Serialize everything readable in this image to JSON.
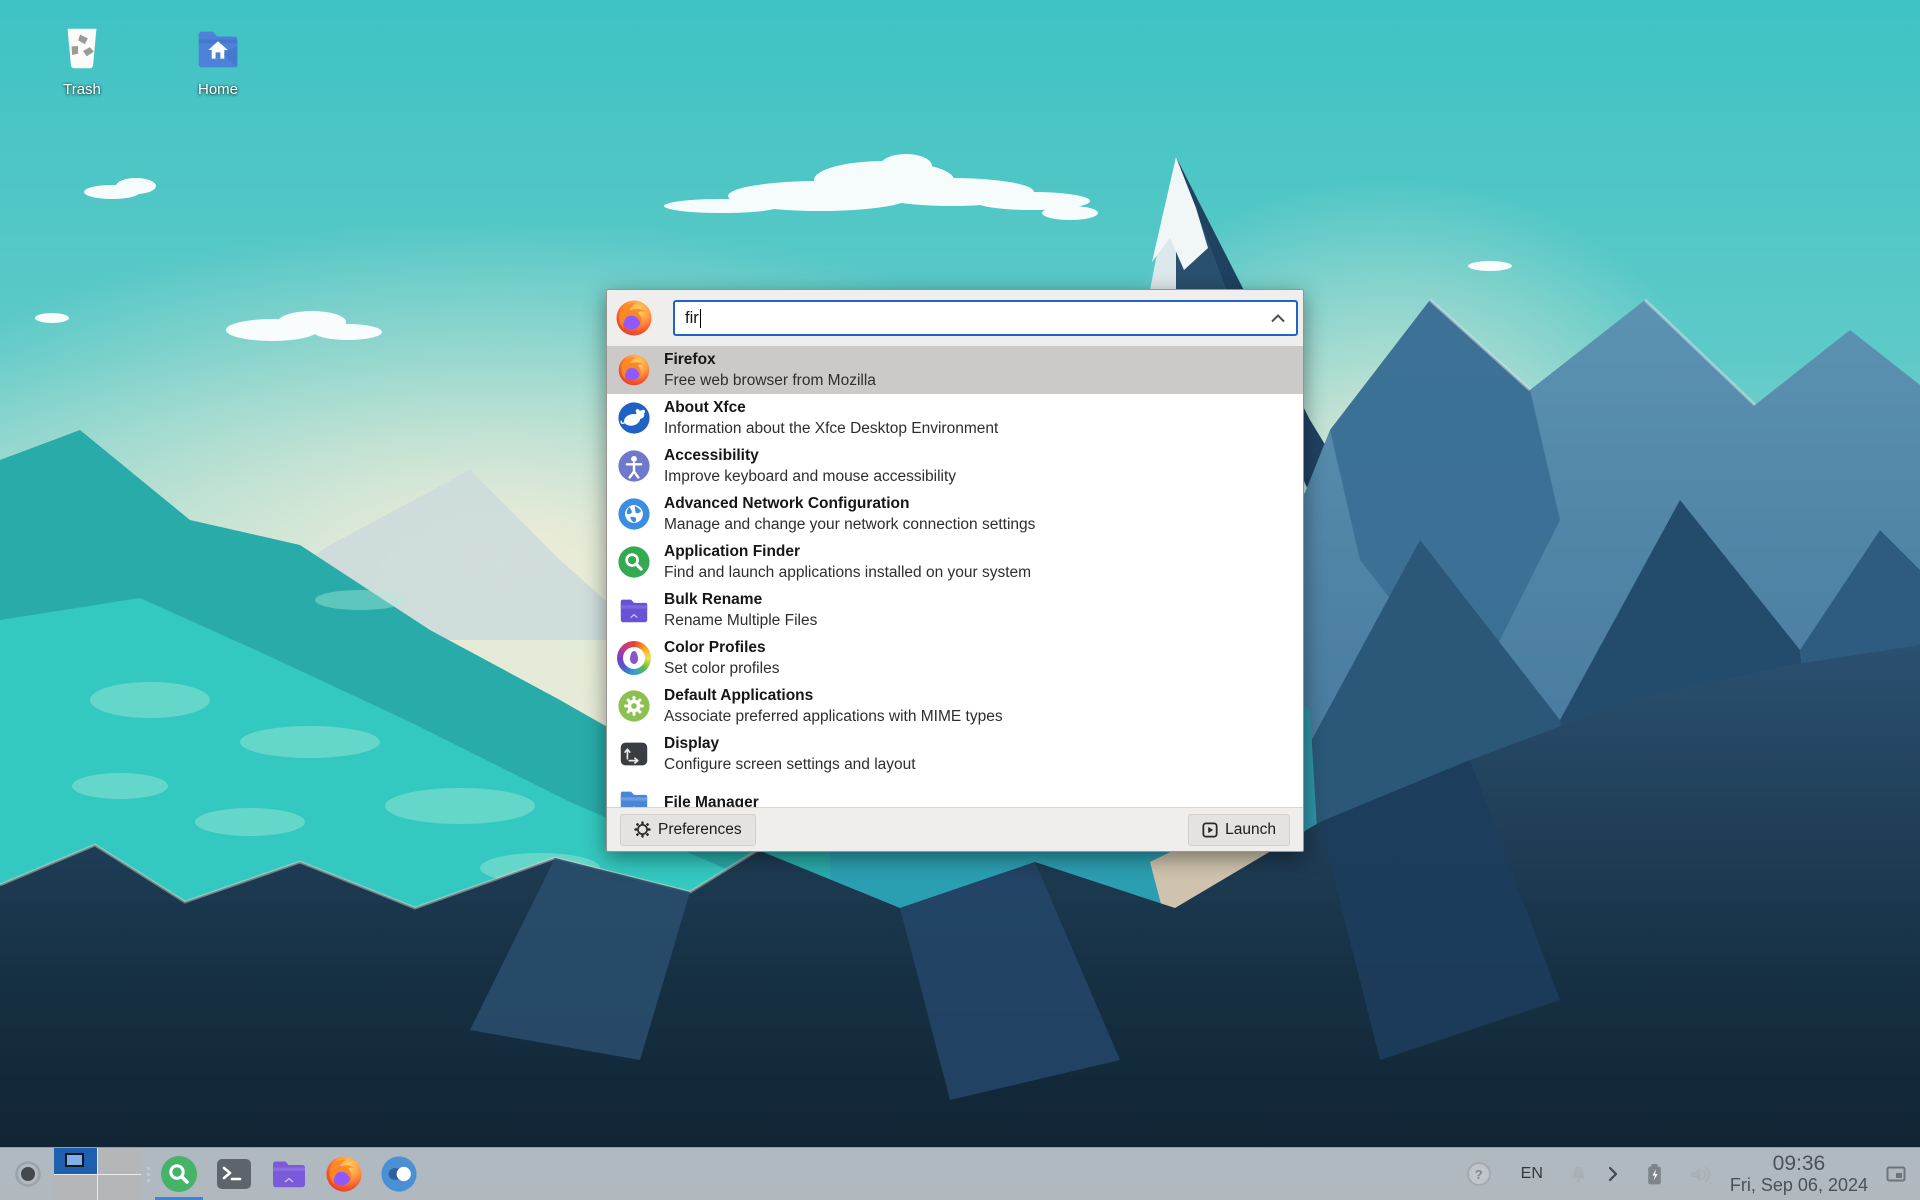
{
  "desktop": {
    "icons": [
      {
        "name": "trash",
        "label": "Trash"
      },
      {
        "name": "home",
        "label": "Home"
      }
    ]
  },
  "app_finder": {
    "window_icon": "firefox-icon",
    "search": {
      "value": "fir"
    },
    "results": [
      {
        "icon": "firefox-icon",
        "title": "Firefox",
        "subtitle": "Free web browser from Mozilla",
        "selected": true
      },
      {
        "icon": "xfce-icon",
        "title": "About Xfce",
        "subtitle": "Information about the Xfce Desktop Environment",
        "selected": false
      },
      {
        "icon": "accessibility-icon",
        "title": "Accessibility",
        "subtitle": "Improve keyboard and mouse accessibility",
        "selected": false
      },
      {
        "icon": "network-icon",
        "title": "Advanced Network Configuration",
        "subtitle": "Manage and change your network connection settings",
        "selected": false
      },
      {
        "icon": "app-finder-icon",
        "title": "Application Finder",
        "subtitle": "Find and launch applications installed on your system",
        "selected": false
      },
      {
        "icon": "bulk-rename-icon",
        "title": "Bulk Rename",
        "subtitle": "Rename Multiple Files",
        "selected": false
      },
      {
        "icon": "color-profiles-icon",
        "title": "Color Profiles",
        "subtitle": "Set color profiles",
        "selected": false
      },
      {
        "icon": "default-apps-icon",
        "title": "Default Applications",
        "subtitle": "Associate preferred applications with MIME types",
        "selected": false
      },
      {
        "icon": "display-icon",
        "title": "Display",
        "subtitle": "Configure screen settings and layout",
        "selected": false
      },
      {
        "icon": "file-manager-icon",
        "title": "File Manager",
        "subtitle": "",
        "selected": false
      }
    ],
    "footer": {
      "preferences_label": "Preferences",
      "launch_label": "Launch"
    }
  },
  "panel": {
    "workspace_switcher": {
      "workspaces": 4,
      "active_workspace": 1
    },
    "launchers": [
      {
        "icon": "application-finder-icon",
        "active": true
      },
      {
        "icon": "terminal-icon",
        "active": false
      },
      {
        "icon": "file-manager-icon",
        "active": false
      },
      {
        "icon": "firefox-icon",
        "active": false
      },
      {
        "icon": "settings-toggle-icon",
        "active": false
      }
    ],
    "tray": {
      "help_badge": "?",
      "keyboard_layout": "EN",
      "icons": [
        "notifications-bell-icon",
        "expand-chevron-icon",
        "battery-charging-icon",
        "volume-icon",
        "show-desktop-icon"
      ]
    },
    "clock": {
      "time": "09:36",
      "date": "Fri, Sep 06, 2024"
    }
  },
  "colors": {
    "accent_blue": "#1f64c8",
    "selection_gray": "#cbcac8",
    "dialog_bg": "#efeeec",
    "workspace_active_blue": "#1e5fb0",
    "launcher_underline_blue": "#3f83d6",
    "sky_teal_top": "#3fc2c4",
    "horizon_cream": "#f4ecd8",
    "foreground_navy": "#163043"
  }
}
